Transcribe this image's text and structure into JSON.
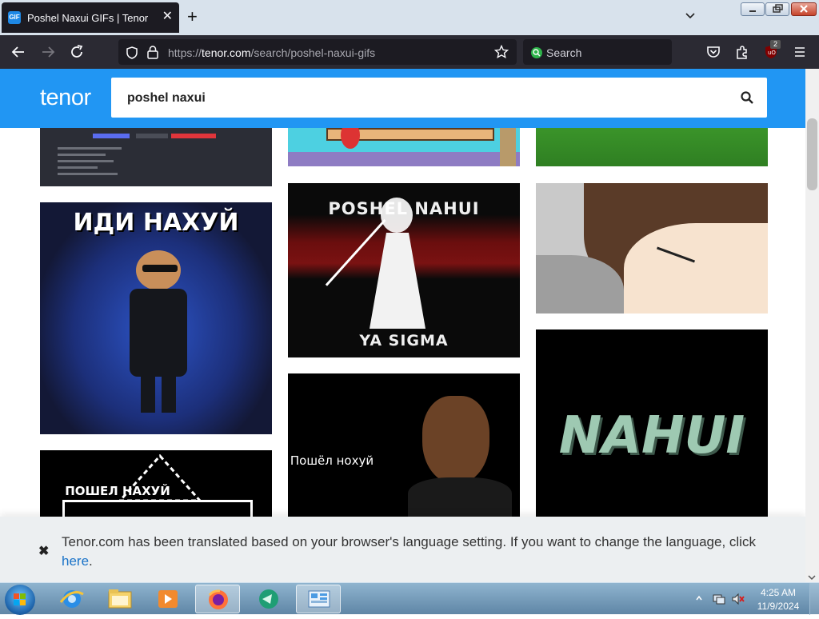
{
  "browser": {
    "tab": {
      "favicon_text": "GIF",
      "title": "Poshel Naxui GIFs | Tenor",
      "close": "✕"
    },
    "new_tab_label": "+",
    "url": {
      "prefix": "https://",
      "domain": "tenor.com",
      "path": "/search/poshel-naxui-gifs"
    },
    "search_placeholder": "Search",
    "extension_badge": "2"
  },
  "page": {
    "logo": "tenor",
    "search_query": "poshel naxui",
    "gifs": [
      {
        "caption": ""
      },
      {
        "caption": ""
      },
      {
        "caption": ""
      },
      {
        "caption": "ИДИ НАХУЙ"
      },
      {
        "caption": "POSHEL NAHUI"
      },
      {
        "caption": "YA SIGMA"
      },
      {
        "caption": ""
      },
      {
        "caption": "ПОШЕЛ НАХУЙ"
      },
      {
        "caption": "Пошёл нохуй"
      },
      {
        "caption": "NAHUI"
      }
    ]
  },
  "banner": {
    "close": "✖",
    "text": "Tenor.com has been translated based on your browser's language setting. If you want to change the language, click",
    "link": "here",
    "end": "."
  },
  "taskbar": {
    "time": "4:25 AM",
    "date": "11/9/2024"
  },
  "colors": {
    "tenor_blue": "#2196f3",
    "browser_dark": "#2b2a33",
    "link": "#1a73c8"
  }
}
